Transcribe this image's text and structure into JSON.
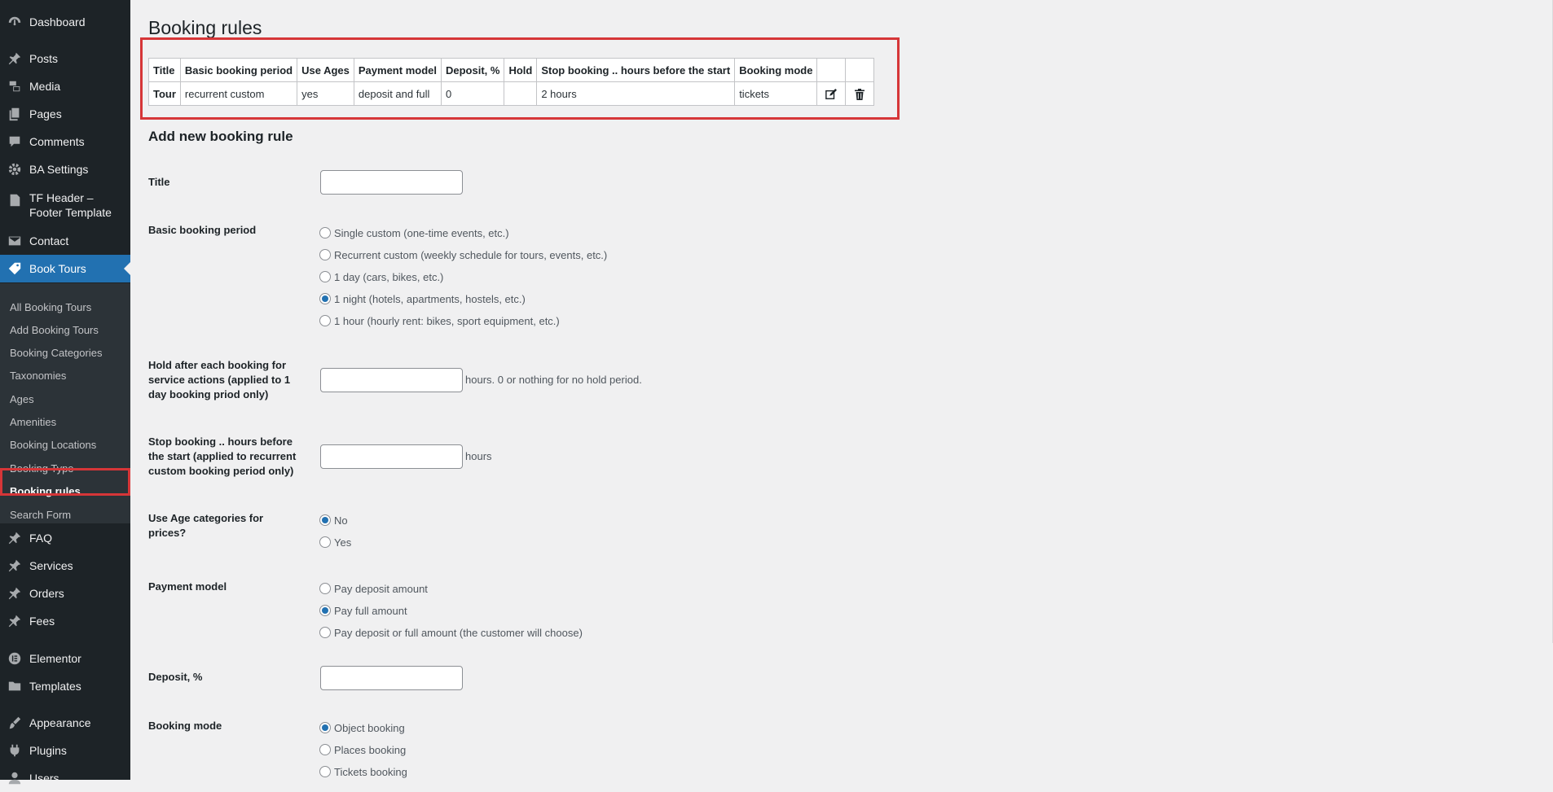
{
  "sidebar": {
    "menu": [
      {
        "label": "Dashboard",
        "icon": "dashboard-icon"
      },
      {
        "label": "Posts",
        "icon": "pin-icon"
      },
      {
        "label": "Media",
        "icon": "media-icon"
      },
      {
        "label": "Pages",
        "icon": "pages-icon"
      },
      {
        "label": "Comments",
        "icon": "comment-icon"
      },
      {
        "label": "BA Settings",
        "icon": "gear-icon"
      },
      {
        "label": "TF Header – Footer Template",
        "icon": "document-icon"
      },
      {
        "label": "Contact",
        "icon": "mail-icon"
      },
      {
        "label": "Book Tours",
        "icon": "tag-icon"
      },
      {
        "label": "FAQ",
        "icon": "pin-icon"
      },
      {
        "label": "Services",
        "icon": "pin-icon"
      },
      {
        "label": "Orders",
        "icon": "pin-icon"
      },
      {
        "label": "Fees",
        "icon": "pin-icon"
      },
      {
        "label": "Elementor",
        "icon": "elementor-icon"
      },
      {
        "label": "Templates",
        "icon": "folder-icon"
      },
      {
        "label": "Appearance",
        "icon": "brush-icon"
      },
      {
        "label": "Plugins",
        "icon": "plug-icon"
      },
      {
        "label": "Users",
        "icon": "user-icon"
      }
    ],
    "submenu": [
      "All Booking Tours",
      "Add Booking Tours",
      "Booking Categories",
      "Taxonomies",
      "Ages",
      "Amenities",
      "Booking Locations",
      "Booking Type",
      "Booking rules",
      "Search Form"
    ],
    "active_submenu": "Booking rules"
  },
  "page": {
    "title": "Booking rules",
    "section_title": "Add new booking rule"
  },
  "rules_table": {
    "headers": [
      "Title",
      "Basic booking period",
      "Use Ages",
      "Payment model",
      "Deposit, %",
      "Hold",
      "Stop booking .. hours before the start",
      "Booking mode"
    ],
    "rows": [
      [
        "Tour",
        "recurrent custom",
        "yes",
        "deposit and full",
        "0",
        "",
        "2 hours",
        "tickets"
      ]
    ],
    "row_actions": [
      "edit-icon",
      "trash-icon"
    ]
  },
  "form": {
    "title_label": "Title",
    "title_value": "",
    "period_label": "Basic booking period",
    "period_options": [
      "Single custom (one-time events, etc.)",
      "Recurrent custom (weekly schedule for tours, events, etc.)",
      "1 day (cars, bikes, etc.)",
      "1 night (hotels, apartments, hostels, etc.)",
      "1 hour (hourly rent: bikes, sport equipment, etc.)"
    ],
    "period_selected": "1 night (hotels, apartments, hostels, etc.)",
    "hold_label": "Hold after each booking for service actions (applied to 1 day booking priod only)",
    "hold_value": "",
    "hold_suffix": "hours. 0 or nothing for no hold period.",
    "stop_label": "Stop booking .. hours before the start (applied to recurrent custom booking period only)",
    "stop_value": "",
    "stop_suffix": "hours",
    "ages_label": "Use Age categories for prices?",
    "ages_options": [
      "No",
      "Yes"
    ],
    "ages_selected": "No",
    "payment_label": "Payment model",
    "payment_options": [
      "Pay deposit amount",
      "Pay full amount",
      "Pay deposit or full amount (the customer will choose)"
    ],
    "payment_selected": "Pay full amount",
    "deposit_label": "Deposit, %",
    "deposit_value": "",
    "mode_label": "Booking mode",
    "mode_options": [
      "Object booking",
      "Places booking",
      "Tickets booking"
    ],
    "mode_selected": "Object booking"
  },
  "colors": {
    "sidebar_bg": "#1d2327",
    "submenu_bg": "#2c3338",
    "accent": "#2271b1",
    "highlight_border": "#d63638",
    "page_bg": "#f0f0f1"
  }
}
